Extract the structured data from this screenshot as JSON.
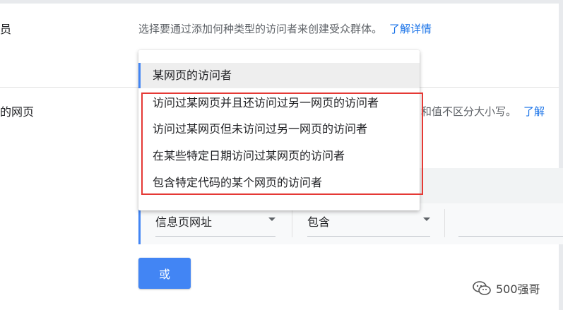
{
  "rows": [
    {
      "label": "员",
      "description": "选择要通过添加何种类型的访问者来创建受众群体。",
      "link": "了解详情"
    },
    {
      "label": "的网页",
      "description": "和值不区分大小写。",
      "link": "了解"
    }
  ],
  "dropdown": {
    "selected": "某网页的访问者",
    "options": [
      "某网页的访问者",
      "访问过某网页并且还访问过另一网页的访问者",
      "访问过某网页但未访问过另一网页的访问者",
      "在某些特定日期访问过某网页的访问者",
      "包含特定代码的某个网页的访问者"
    ]
  },
  "rule": {
    "field_select": "信息页网址",
    "operator_select": "包含",
    "value": ""
  },
  "or_button": "或",
  "watermark": "500强哥",
  "colors": {
    "accent": "#4285f4",
    "link": "#1a73e8",
    "highlight": "#e53935"
  }
}
